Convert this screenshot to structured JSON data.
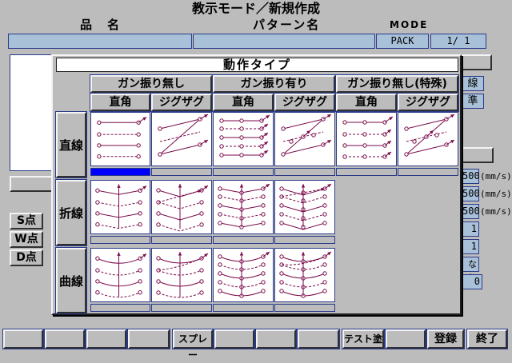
{
  "window": {
    "title": "教示モード／新規作成"
  },
  "header": {
    "name_label": "品　名",
    "pattern_label": "パターン名",
    "mode_label": "MODE",
    "mode_value": "PACK",
    "page_value": "1/ 1"
  },
  "side": {
    "s_point": "S点",
    "w_point": "W点",
    "d_point": "D点",
    "partial_1": "線",
    "partial_2": "準",
    "speeds": [
      "500",
      "500",
      "500"
    ],
    "speed_unit": "(mm/s)",
    "v1": "1",
    "v2": "1",
    "v3": "なし",
    "v4": "0"
  },
  "dialog": {
    "title": "動作タイプ",
    "groups": [
      "ガン振り無し",
      "ガン振り有り",
      "ガン振り無し(特殊)"
    ],
    "subcols": [
      "直角",
      "ジグザグ",
      "直角",
      "ジグザグ",
      "直角",
      "ジグザグ"
    ],
    "rows": [
      "直線",
      "折線",
      "曲線"
    ],
    "selected": "直線-直角-ガン振り無し",
    "pattern_color": "#7a0a4a",
    "selection_color": "#0000ff"
  },
  "footer": {
    "keys": [
      "",
      "",
      "",
      "",
      "スプレー",
      "",
      "",
      "",
      "テスト塗",
      "",
      "登録",
      "終了"
    ]
  }
}
